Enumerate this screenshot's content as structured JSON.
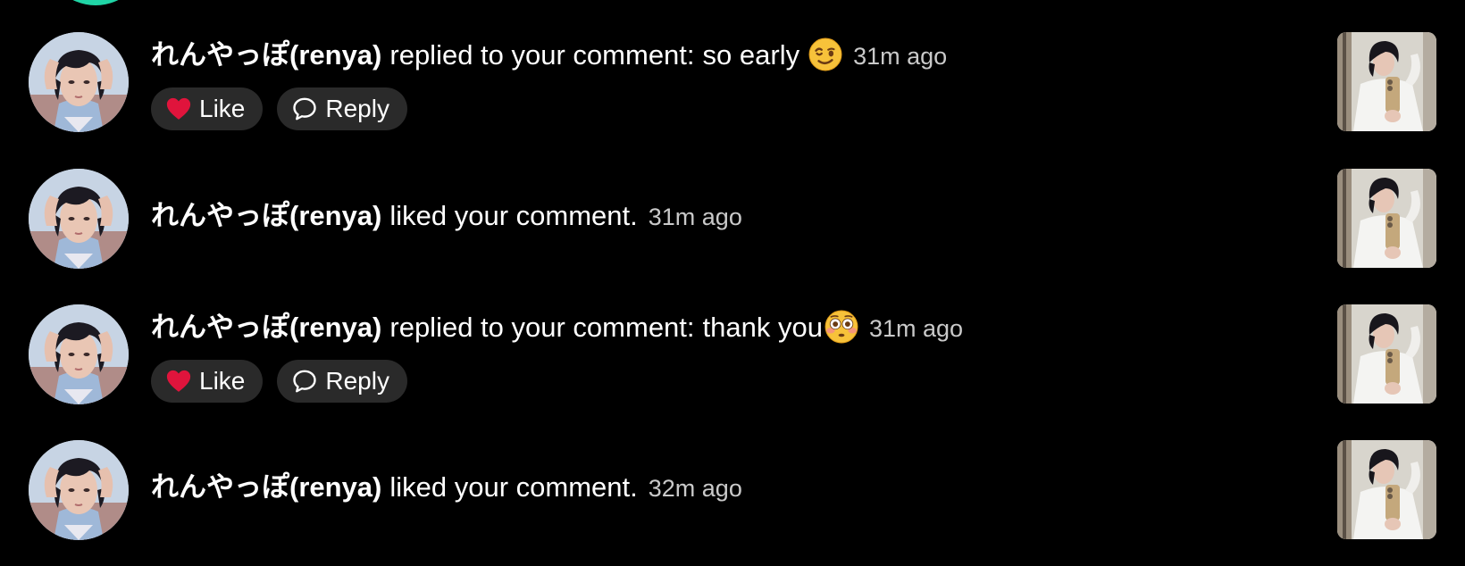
{
  "colors": {
    "background": "#000000",
    "text": "#ffffff",
    "timestamp": "#c9c9c9",
    "button_bg": "#2a2a2a",
    "heart": "#e0143c",
    "prev_avatar": "#20d5a6"
  },
  "notifications": [
    {
      "username": "れんやっぽ(renya)",
      "action": "replied to your comment:",
      "comment": "so early",
      "emoji": "winking-face-emoji",
      "time": "31m ago",
      "like_label": "Like",
      "reply_label": "Reply"
    },
    {
      "username": "れんやっぽ(renya)",
      "action": "liked your comment.",
      "time": "31m ago"
    },
    {
      "username": "れんやっぽ(renya)",
      "action": "replied to your comment:",
      "comment": "thank you",
      "emoji": "flushed-face-emoji",
      "time": "31m ago",
      "like_label": "Like",
      "reply_label": "Reply"
    },
    {
      "username": "れんやっぽ(renya)",
      "action": "liked your comment.",
      "time": "32m ago"
    }
  ]
}
